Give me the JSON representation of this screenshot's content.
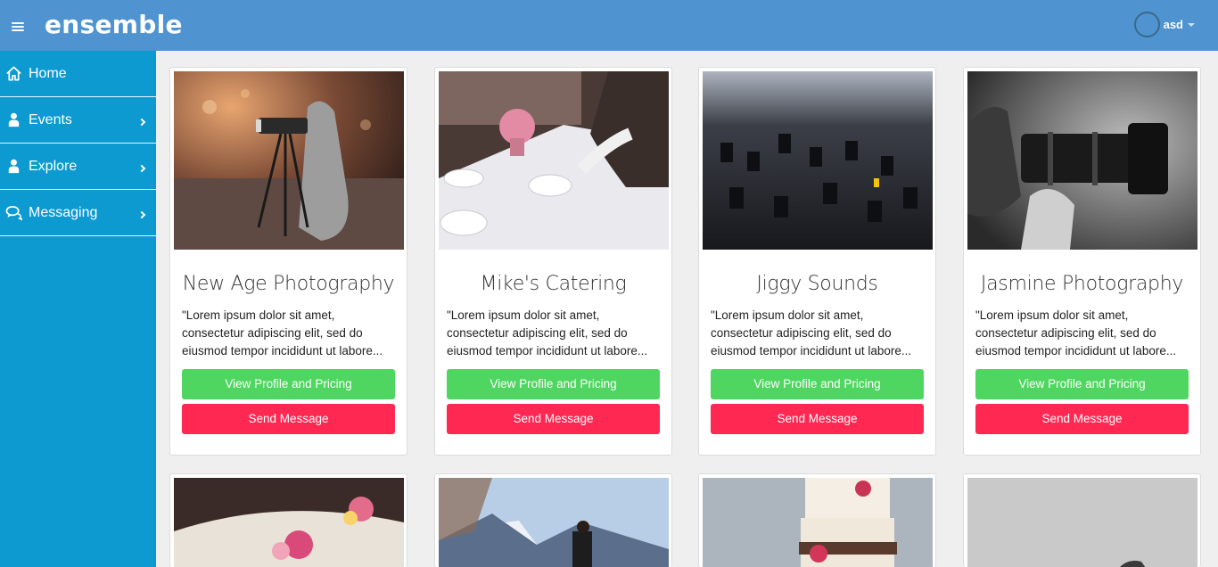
{
  "app": {
    "brand": "ensemble",
    "username": "asd"
  },
  "sidebar": {
    "items": [
      {
        "label": "Home",
        "icon": "home-icon",
        "has_submenu": false
      },
      {
        "label": "Events",
        "icon": "user-icon",
        "has_submenu": true
      },
      {
        "label": "Explore",
        "icon": "user-icon",
        "has_submenu": true
      },
      {
        "label": "Messaging",
        "icon": "chat-icon",
        "has_submenu": true
      }
    ]
  },
  "buttons": {
    "profile": "View Profile and Pricing",
    "message": "Send Message"
  },
  "cards": [
    {
      "title": "New Age Photography",
      "description": "\"Lorem ipsum dolor sit amet, consectetur adipiscing elit, sed do eiusmod tempor incididunt ut labore..."
    },
    {
      "title": "Mike's Catering",
      "description": "\"Lorem ipsum dolor sit amet, consectetur adipiscing elit, sed do eiusmod tempor incididunt ut labore..."
    },
    {
      "title": "Jiggy Sounds",
      "description": "\"Lorem ipsum dolor sit amet, consectetur adipiscing elit, sed do eiusmod tempor incididunt ut labore..."
    },
    {
      "title": "Jasmine Photography",
      "description": "\"Lorem ipsum dolor sit amet, consectetur adipiscing elit, sed do eiusmod tempor incididunt ut labore..."
    }
  ],
  "colors": {
    "topbar": "#4f93d0",
    "sidebar": "#0d9ad0",
    "primary_button": "#4fd661",
    "danger_button": "#fe2853"
  }
}
